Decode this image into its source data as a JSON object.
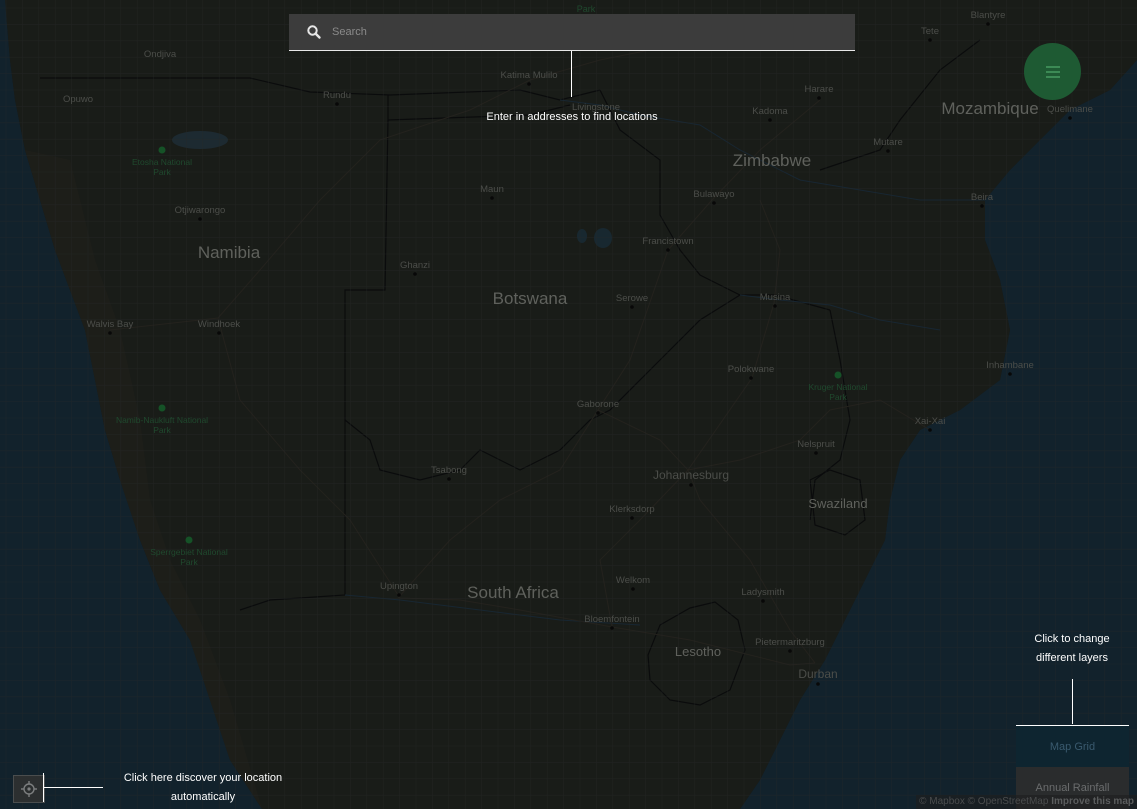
{
  "search": {
    "placeholder": "Search",
    "tooltip": "Enter in addresses to find locations"
  },
  "locate": {
    "tooltip_line1": "Click here discover your location",
    "tooltip_line2": "automatically"
  },
  "layers": {
    "tooltip_line1": "Click to change",
    "tooltip_line2": "different layers",
    "items": [
      {
        "label": "Map Grid",
        "active": true
      },
      {
        "label": "Annual Rainfall",
        "active": false
      }
    ]
  },
  "attribution": {
    "mapbox": "© Mapbox",
    "osm": "© OpenStreetMap",
    "improve": "Improve this map"
  },
  "map": {
    "countries": [
      {
        "name": "Namibia"
      },
      {
        "name": "Botswana"
      },
      {
        "name": "Zimbabwe"
      },
      {
        "name": "Mozambique"
      },
      {
        "name": "South Africa"
      },
      {
        "name": "Lesotho"
      },
      {
        "name": "Swaziland"
      }
    ],
    "cities": [
      {
        "name": "Ondjiva"
      },
      {
        "name": "Opuwo"
      },
      {
        "name": "Rundu"
      },
      {
        "name": "Katima Mulilo"
      },
      {
        "name": "Livingstone"
      },
      {
        "name": "Harare"
      },
      {
        "name": "Kadoma"
      },
      {
        "name": "Tete"
      },
      {
        "name": "Blantyre"
      },
      {
        "name": "Quelimane"
      },
      {
        "name": "Mutare"
      },
      {
        "name": "Beira"
      },
      {
        "name": "Maun"
      },
      {
        "name": "Bulawayo"
      },
      {
        "name": "Otjiwarongo"
      },
      {
        "name": "Francistown"
      },
      {
        "name": "Ghanzi"
      },
      {
        "name": "Serowe"
      },
      {
        "name": "Musina"
      },
      {
        "name": "Walvis Bay"
      },
      {
        "name": "Windhoek"
      },
      {
        "name": "Polokwane"
      },
      {
        "name": "Inhambane"
      },
      {
        "name": "Gaborone"
      },
      {
        "name": "Xai-Xai"
      },
      {
        "name": "Nelspruit"
      },
      {
        "name": "Tsabong"
      },
      {
        "name": "Johannesburg"
      },
      {
        "name": "Klerksdorp"
      },
      {
        "name": "Upington"
      },
      {
        "name": "Welkom"
      },
      {
        "name": "Ladysmith"
      },
      {
        "name": "Bloemfontein"
      },
      {
        "name": "Pietermaritzburg"
      },
      {
        "name": "Durban"
      }
    ],
    "parks": [
      {
        "name": "Etosha National Park"
      },
      {
        "name": "Namib-Naukluft National Park"
      },
      {
        "name": "Sperrgebiet National Park"
      },
      {
        "name": "Kruger National Park"
      }
    ],
    "top_label": "Park"
  }
}
